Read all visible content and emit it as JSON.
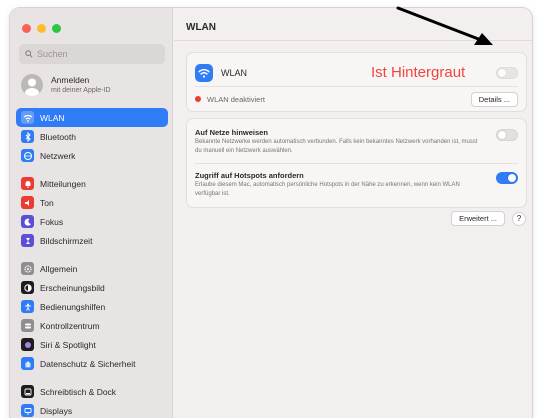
{
  "sidebar": {
    "search_placeholder": "Suchen",
    "account": {
      "name": "Anmelden",
      "subtitle": "mit deiner Apple-ID"
    },
    "groups": [
      [
        {
          "label": "WLAN",
          "icon": "wifi-icon",
          "color": "#2f7cf6",
          "active": true
        },
        {
          "label": "Bluetooth",
          "icon": "bluetooth-icon",
          "color": "#2f7cf6",
          "active": false
        },
        {
          "label": "Netzwerk",
          "icon": "globe-icon",
          "color": "#2f7cf6",
          "active": false
        }
      ],
      [
        {
          "label": "Mitteilungen",
          "icon": "bell-icon",
          "color": "#ec3b33",
          "active": false
        },
        {
          "label": "Ton",
          "icon": "speaker-icon",
          "color": "#ec3b33",
          "active": false
        },
        {
          "label": "Fokus",
          "icon": "moon-icon",
          "color": "#5b4fd6",
          "active": false
        },
        {
          "label": "Bildschirmzeit",
          "icon": "hourglass-icon",
          "color": "#5b4fd6",
          "active": false
        }
      ],
      [
        {
          "label": "Allgemein",
          "icon": "gear-icon",
          "color": "#8e8e93",
          "active": false
        },
        {
          "label": "Erscheinungsbild",
          "icon": "appearance-icon",
          "color": "#1d1d1f",
          "active": false
        },
        {
          "label": "Bedienungshilfen",
          "icon": "accessibility-icon",
          "color": "#2f7cf6",
          "active": false
        },
        {
          "label": "Kontrollzentrum",
          "icon": "control-center-icon",
          "color": "#8e8e93",
          "active": false
        },
        {
          "label": "Siri & Spotlight",
          "icon": "siri-icon",
          "color": "#1d1d1f",
          "active": false
        },
        {
          "label": "Datenschutz & Sicherheit",
          "icon": "hand-icon",
          "color": "#2f7cf6",
          "active": false
        }
      ],
      [
        {
          "label": "Schreibtisch & Dock",
          "icon": "dock-icon",
          "color": "#1d1d1f",
          "active": false
        },
        {
          "label": "Displays",
          "icon": "display-icon",
          "color": "#2f7cf6",
          "active": false
        }
      ]
    ]
  },
  "content": {
    "title": "WLAN",
    "wlan": {
      "label": "WLAN",
      "enabled": false,
      "annotation": "Ist Hintergraut"
    },
    "status": {
      "text": "WLAN deaktiviert",
      "details_label": "Details ..."
    },
    "options": [
      {
        "title": "Auf Netze hinweisen",
        "description": "Bekannte Netzwerke werden automatisch verbunden. Falls kein bekanntes Netzwerk vorhanden ist, musst du manuell ein Netzwerk auswählen.",
        "enabled": false
      },
      {
        "title": "Zugriff auf Hotspots anfordern",
        "description": "Erlaube diesem Mac, automatisch persönliche Hotspots in der Nähe zu erkennen, wenn kein WLAN verfügbar ist.",
        "enabled": true
      }
    ],
    "advanced_label": "Erweitert ...",
    "help_label": "?"
  },
  "colors": {
    "accent": "#2f7cf6",
    "annotation": "#f3443e",
    "status_dot": "#ec3b33"
  }
}
